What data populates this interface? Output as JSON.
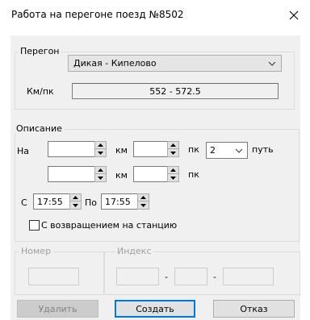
{
  "window": {
    "title": "Работа на перегоне поезд №8502",
    "close_icon": "close-icon"
  },
  "peregon": {
    "legend": "Перегон",
    "selected": "Дикая - Кипелово",
    "km_pk_label": "Км/пк",
    "km_pk_value": "552 - 572.5"
  },
  "description": {
    "legend": "Описание",
    "na_label": "На",
    "km_label": "км",
    "pk_label": "пк",
    "row1": {
      "km": "",
      "pk": ""
    },
    "row2": {
      "km": "",
      "pk": ""
    },
    "track_value": "2",
    "track_label": "путь",
    "from_label": "С",
    "from_time": "17:55",
    "to_label": "По",
    "to_time": "17:55",
    "return_checkbox_label": "С возвращением на станцию",
    "return_checked": false
  },
  "number": {
    "legend": "Номер",
    "value": ""
  },
  "index": {
    "legend": "Индекс",
    "separator": "-",
    "part1": "",
    "part2": "",
    "part3": ""
  },
  "buttons": {
    "delete": "Удалить",
    "create": "Создать",
    "cancel": "Отказ"
  }
}
